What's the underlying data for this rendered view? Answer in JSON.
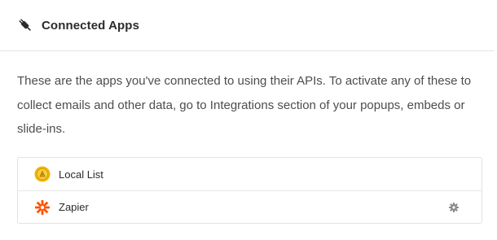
{
  "header": {
    "title": "Connected Apps",
    "icon": "plug-icon"
  },
  "description": "These are the apps you've connected to using their APIs. To activate any of these to collect emails and other data, go to Integrations section of your popups, embeds or slide-ins.",
  "apps": [
    {
      "name": "Local List",
      "icon": "local-list-icon",
      "icon_color": "#f0b400",
      "has_settings": false
    },
    {
      "name": "Zapier",
      "icon": "zapier-icon",
      "icon_color": "#ff4f00",
      "has_settings": true,
      "settings_icon": "gear-icon"
    }
  ],
  "colors": {
    "text": "#4d4d4d",
    "heading": "#2b2b2b",
    "border": "#e2e2e2",
    "gear": "#8a8a8a"
  }
}
